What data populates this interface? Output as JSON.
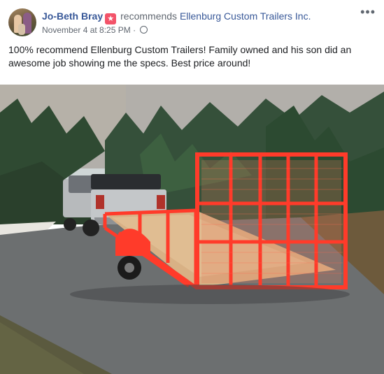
{
  "post": {
    "author": "Jo-Beth Bray",
    "badge_icon": "recommend-star-icon",
    "verb": "recommends",
    "page_name": "Ellenburg Custom Trailers Inc.",
    "timestamp": "November 4 at 8:25 PM",
    "separator": "·",
    "privacy_icon": "globe-icon",
    "more_icon": "more-options-icon",
    "more_label": "•••",
    "text": "100% recommend Ellenburg Custom Trailers! Family owned and his son did an awesome job showing me the specs. Best price around!"
  },
  "colors": {
    "link": "#385898",
    "meta": "#606770",
    "badge": "#f35369",
    "trailer": "#ff3b2a"
  }
}
